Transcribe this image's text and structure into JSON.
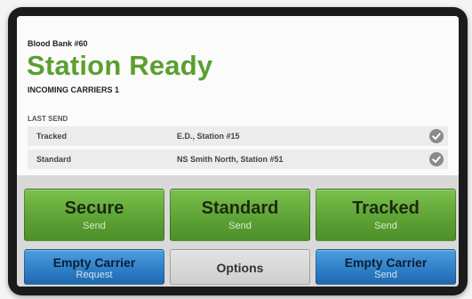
{
  "header": {
    "bank_title": "Blood Bank #60",
    "station_status": "Station Ready",
    "incoming": "INCOMING CARRIERS 1",
    "status_color": "#5b9f2f"
  },
  "last_send": {
    "title": "LAST SEND",
    "rows": [
      {
        "type": "Tracked",
        "destination": "E.D., Station #15",
        "icon": "check-circle-icon"
      },
      {
        "type": "Standard",
        "destination": "NS Smith North, Station #51",
        "icon": "check-circle-icon"
      }
    ]
  },
  "buttons": {
    "secure": {
      "label": "Secure",
      "sub": "Send"
    },
    "standard": {
      "label": "Standard",
      "sub": "Send"
    },
    "tracked": {
      "label": "Tracked",
      "sub": "Send"
    },
    "empty_request": {
      "label": "Empty Carrier",
      "sub": "Request"
    },
    "options": {
      "label": "Options"
    },
    "empty_send": {
      "label": "Empty Carrier",
      "sub": "Send"
    }
  },
  "colors": {
    "green": "#5ea336",
    "blue": "#2f80c8",
    "gray": "#cfcfcf"
  }
}
